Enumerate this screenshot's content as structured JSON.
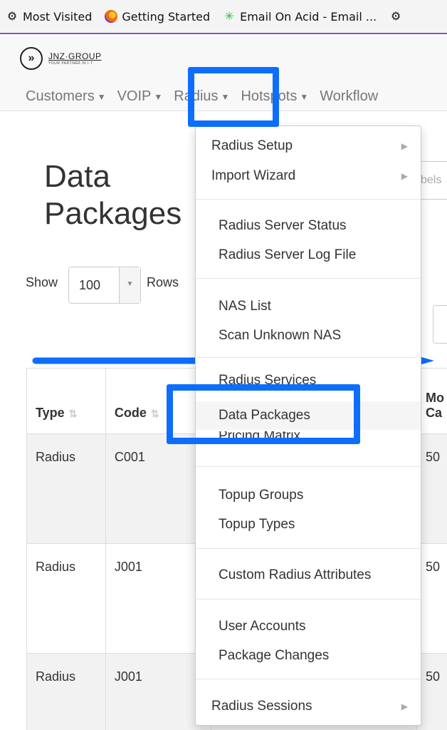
{
  "bookmarks": [
    {
      "label": "Most Visited",
      "icon": "gear-icon"
    },
    {
      "label": "Getting Started",
      "icon": "firefox-icon"
    },
    {
      "label": "Email On Acid - Email ...",
      "icon": "spark-icon"
    }
  ],
  "logo": {
    "name": "JNZ·GROUP",
    "tagline": "YOUR PARTNER IN I.T",
    "symbol": "»"
  },
  "nav": {
    "items": [
      {
        "label": "Customers"
      },
      {
        "label": "VOIP"
      },
      {
        "label": "Radius"
      },
      {
        "label": "Hotspots"
      },
      {
        "label": "Workflow"
      }
    ]
  },
  "page": {
    "title": "Data Packages",
    "show_label": "Show",
    "rows_value": "100",
    "rows_label": "Rows",
    "search_placeholder_fragment": "bels"
  },
  "table": {
    "headers": [
      {
        "label": "Type"
      },
      {
        "label": "Code"
      },
      {
        "label": ""
      },
      {
        "label": "Mo Ca"
      }
    ],
    "rows": [
      {
        "type": "Radius",
        "code": "C001",
        "edge": "50"
      },
      {
        "type": "Radius",
        "code": "J001",
        "edge": "50"
      },
      {
        "type": "Radius",
        "code": "J001",
        "edge": "50"
      }
    ]
  },
  "menu": {
    "radius_setup": "Radius Setup",
    "import_wizard": "Import Wizard",
    "server_status": "Radius Server Status",
    "server_log": "Radius Server Log File",
    "nas_list": "NAS List",
    "scan_nas": "Scan Unknown NAS",
    "radius_services": "Radius Services",
    "data_packages": "Data Packages",
    "pricing_matrix": "Pricing Matrix",
    "topup_groups": "Topup Groups",
    "topup_types": "Topup Types",
    "custom_attributes": "Custom Radius Attributes",
    "user_accounts": "User Accounts",
    "package_changes": "Package Changes",
    "radius_sessions": "Radius Sessions"
  },
  "colors": {
    "highlight": "#0d6efd",
    "bookmark_border": "#7b57c9"
  }
}
